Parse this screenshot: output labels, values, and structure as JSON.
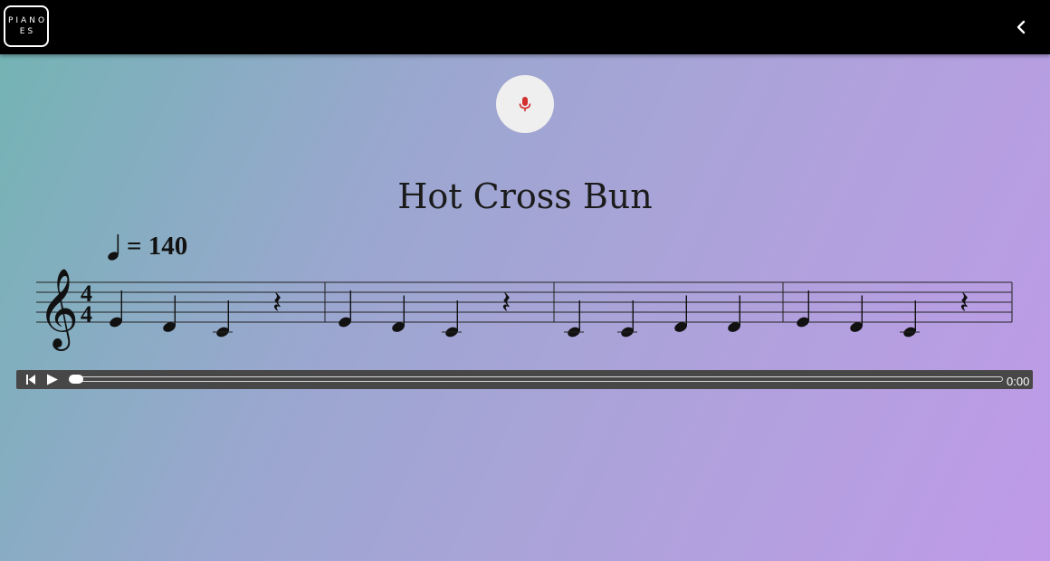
{
  "header": {
    "logo_line1": "PIANO",
    "logo_line2": "ES",
    "back_icon": "chevron-left-icon"
  },
  "mic": {
    "icon": "microphone-icon",
    "color": "#d32f2f"
  },
  "song": {
    "title": "Hot Cross Bun"
  },
  "score": {
    "tempo_bpm": "= 140",
    "clef": "treble",
    "time_signature": "4/4",
    "measures": [
      [
        "E4 quarter",
        "D4 quarter",
        "C4 quarter",
        "quarter rest"
      ],
      [
        "E4 quarter",
        "D4 quarter",
        "C4 quarter",
        "quarter rest"
      ],
      [
        "C4 quarter",
        "C4 quarter",
        "D4 quarter",
        "D4 quarter"
      ],
      [
        "E4 quarter",
        "D4 quarter",
        "C4 quarter",
        "quarter rest"
      ]
    ]
  },
  "player": {
    "skip_icon": "skip-back-icon",
    "play_icon": "play-icon",
    "time": "0:00",
    "progress": 0
  }
}
